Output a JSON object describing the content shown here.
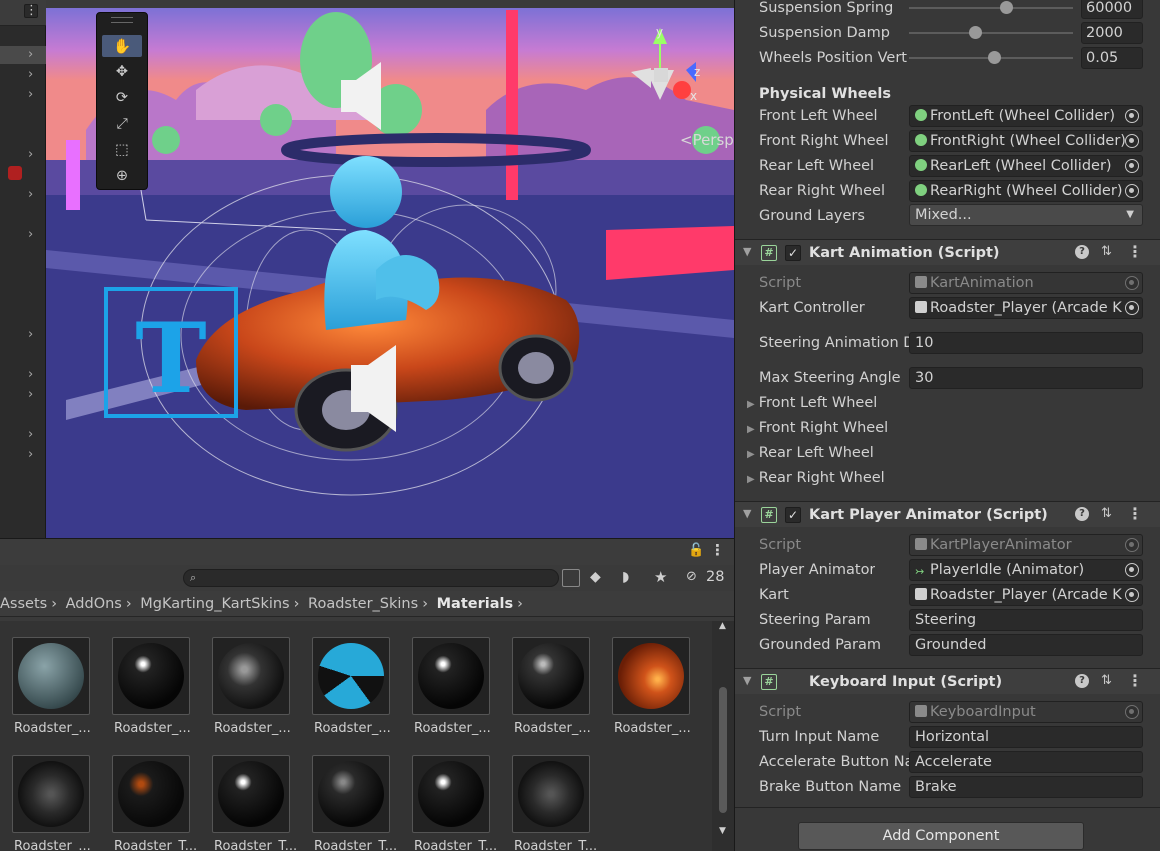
{
  "scene": {
    "persp_label": "<Persp",
    "gizmo_axes": {
      "x": "x",
      "y": "y",
      "z": "z"
    }
  },
  "tools": [
    "hand-icon",
    "move-icon",
    "rotate-icon",
    "scale-icon",
    "rect-icon",
    "transform-icon"
  ],
  "inspector": {
    "suspension_spring": {
      "label": "Suspension Spring",
      "value": "60000",
      "level": 0.6
    },
    "suspension_damp": {
      "label": "Suspension Damp",
      "value": "2000",
      "level": 0.4
    },
    "wheels_pos_vert": {
      "label": "Wheels Position Vert",
      "value": "0.05",
      "level": 0.52
    },
    "physical_wheels_header": "Physical Wheels",
    "physical": [
      {
        "label": "Front Left Wheel",
        "value": "FrontLeft (Wheel Collider)"
      },
      {
        "label": "Front Right Wheel",
        "value": "FrontRight (Wheel Collider)"
      },
      {
        "label": "Rear Left Wheel",
        "value": "RearLeft (Wheel Collider)"
      },
      {
        "label": "Rear Right Wheel",
        "value": "RearRight (Wheel Collider)"
      }
    ],
    "ground_layers": {
      "label": "Ground Layers",
      "value": "Mixed..."
    },
    "kart_animation": {
      "title": "Kart Animation (Script)",
      "script_label": "Script",
      "script_value": "KartAnimation",
      "controller_label": "Kart Controller",
      "controller_value": "Roadster_Player (Arcade K",
      "steer_anim_label": "Steering Animation D",
      "steer_anim_value": "10",
      "max_steer_label": "Max Steering Angle",
      "max_steer_value": "30",
      "foldouts": [
        "Front Left Wheel",
        "Front Right Wheel",
        "Rear Left Wheel",
        "Rear Right Wheel"
      ]
    },
    "kart_player_animator": {
      "title": "Kart Player Animator (Script)",
      "script_label": "Script",
      "script_value": "KartPlayerAnimator",
      "player_anim_label": "Player Animator",
      "player_anim_value": "PlayerIdle (Animator)",
      "kart_label": "Kart",
      "kart_value": "Roadster_Player (Arcade K",
      "steer_param_label": "Steering Param",
      "steer_param_value": "Steering",
      "grounded_param_label": "Grounded Param",
      "grounded_param_value": "Grounded"
    },
    "keyboard_input": {
      "title": "Keyboard Input (Script)",
      "script_label": "Script",
      "script_value": "KeyboardInput",
      "turn_label": "Turn Input Name",
      "turn_value": "Horizontal",
      "accel_label": "Accelerate Button Na",
      "accel_value": "Accelerate",
      "brake_label": "Brake Button Name",
      "brake_value": "Brake"
    },
    "add_component": "Add Component"
  },
  "project": {
    "hidden_count": "28",
    "breadcrumb": [
      "Assets",
      "AddOns",
      "MgKarting_KartSkins",
      "Roadster_Skins",
      "Materials"
    ],
    "row1": [
      "Roadster_...",
      "Roadster_...",
      "Roadster_...",
      "Roadster_...",
      "Roadster_...",
      "Roadster_...",
      "Roadster_..."
    ],
    "row2": [
      "Roadster_...",
      "Roadster_T...",
      "Roadster_T...",
      "Roadster_T...",
      "Roadster_T...",
      "Roadster_T..."
    ]
  }
}
